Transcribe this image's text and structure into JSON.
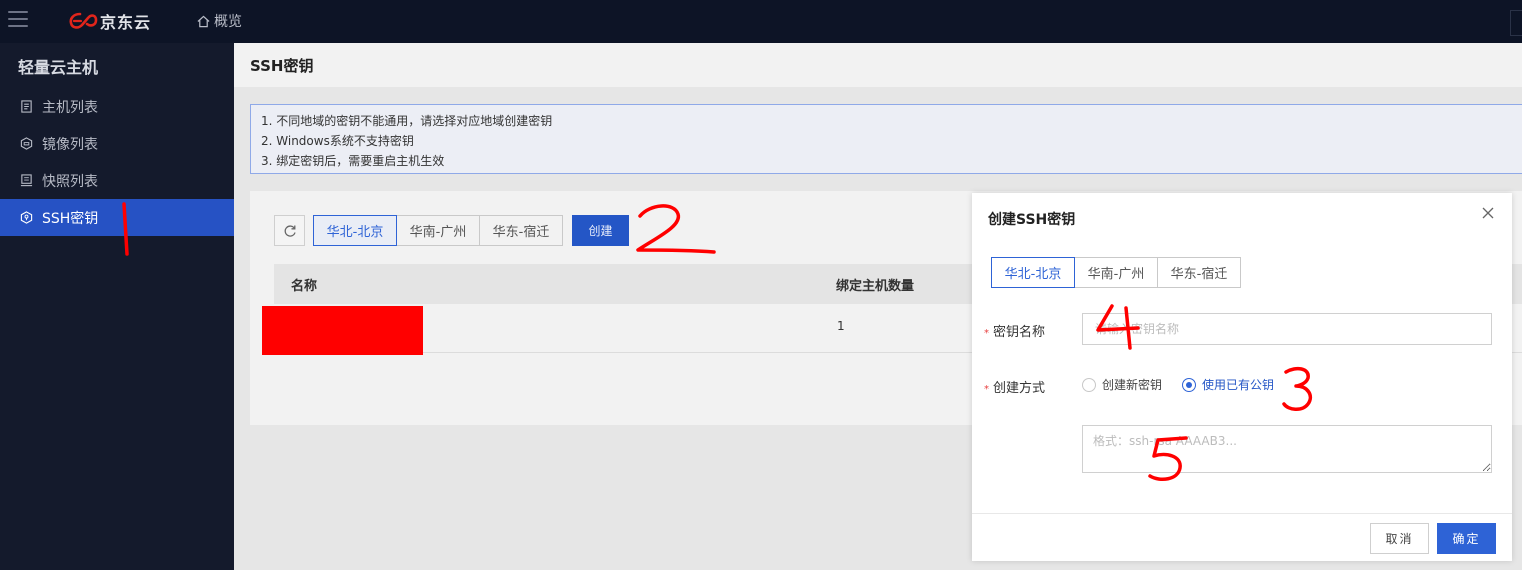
{
  "topbar": {
    "brand": "京东云",
    "overview": "概览"
  },
  "sidebar": {
    "title": "轻量云主机",
    "items": [
      {
        "label": "主机列表"
      },
      {
        "label": "镜像列表"
      },
      {
        "label": "快照列表"
      },
      {
        "label": "SSH密钥"
      }
    ]
  },
  "page": {
    "title": "SSH密钥",
    "notices": [
      "1. 不同地域的密钥不能通用，请选择对应地域创建密钥",
      "2. Windows系统不支持密钥",
      "3. 绑定密钥后，需要重启主机生效"
    ],
    "regions": [
      "华北-北京",
      "华南-广州",
      "华东-宿迁"
    ],
    "create_label": "创建",
    "table": {
      "columns": [
        "名称",
        "绑定主机数量"
      ],
      "rows": [
        {
          "bound_count": "1"
        }
      ]
    }
  },
  "dialog": {
    "title": "创建SSH密钥",
    "regions": [
      "华北-北京",
      "华南-广州",
      "华东-宿迁"
    ],
    "name_label": "密钥名称",
    "name_placeholder": "请输入密钥名称",
    "method_label": "创建方式",
    "method_options": [
      "创建新密钥",
      "使用已有公钥"
    ],
    "key_placeholder": "格式：ssh-rsa AAAAB3...",
    "cancel_label": "取消",
    "ok_label": "确定"
  },
  "annotations": [
    "1",
    "2",
    "3",
    "4",
    "5"
  ],
  "colors": {
    "accent": "#2e63d6",
    "sidebar_active": "#2652c4",
    "annotation": "#ff0000"
  }
}
